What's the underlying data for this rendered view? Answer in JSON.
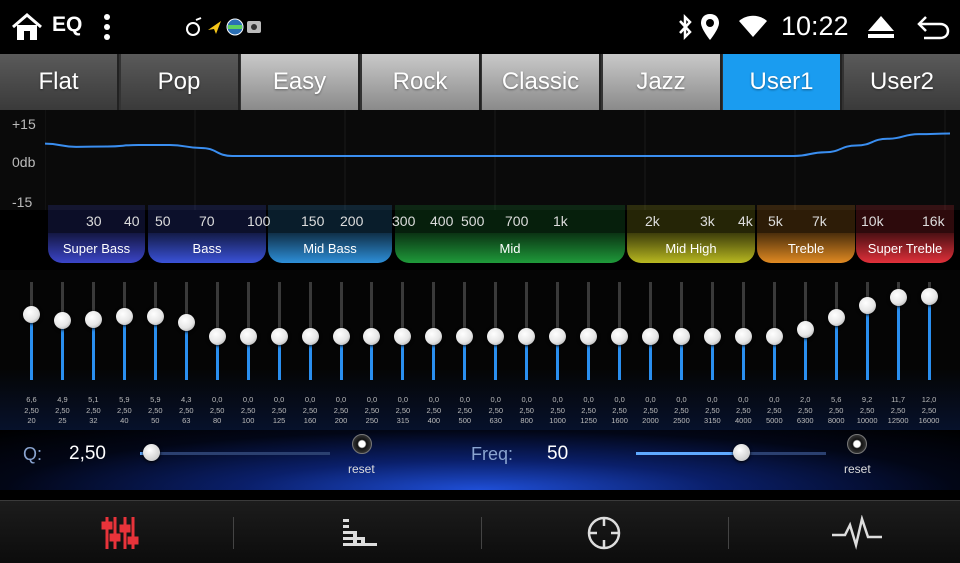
{
  "statusbar": {
    "title": "EQ",
    "time": "10:22",
    "icons": [
      "home-icon",
      "menu-dots-icon",
      "music-notif-icon",
      "nav-notif-icon",
      "globe-notif-icon",
      "camera-notif-icon",
      "bluetooth-icon",
      "location-icon",
      "wifi-icon",
      "eject-icon",
      "back-icon"
    ]
  },
  "presets": [
    {
      "label": "Flat"
    },
    {
      "label": "Pop"
    },
    {
      "label": "Easy"
    },
    {
      "label": "Rock"
    },
    {
      "label": "Classic"
    },
    {
      "label": "Jazz"
    },
    {
      "label": "User1",
      "active": true
    },
    {
      "label": "User2"
    }
  ],
  "graph": {
    "ymax": "+15",
    "ymid": "0db",
    "ymin": "-15"
  },
  "freq_labels": [
    "30",
    "40",
    "50",
    "70",
    "100",
    "150",
    "200",
    "300",
    "400",
    "500",
    "700",
    "1k",
    "2k",
    "3k",
    "4k",
    "5k",
    "7k",
    "10k",
    "16k"
  ],
  "bands": [
    {
      "label": "Super Bass",
      "color": "#3b45c8"
    },
    {
      "label": "Bass",
      "color": "#3a52d8"
    },
    {
      "label": "Mid Bass",
      "color": "#2d8fd8"
    },
    {
      "label": "Mid",
      "color": "#1f9a3a"
    },
    {
      "label": "Mid High",
      "color": "#b8b820"
    },
    {
      "label": "Treble",
      "color": "#e08a22"
    },
    {
      "label": "Super Treble",
      "color": "#e0303a"
    }
  ],
  "eq_bands": [
    {
      "gain": "6,6",
      "q": "2,50",
      "freq": "20",
      "level": 6.6
    },
    {
      "gain": "4,9",
      "q": "2,50",
      "freq": "25",
      "level": 4.9
    },
    {
      "gain": "5,1",
      "q": "2,50",
      "freq": "32",
      "level": 5.1
    },
    {
      "gain": "5,9",
      "q": "2,50",
      "freq": "40",
      "level": 5.9
    },
    {
      "gain": "5,9",
      "q": "2,50",
      "freq": "50",
      "level": 5.9
    },
    {
      "gain": "4,3",
      "q": "2,50",
      "freq": "63",
      "level": 4.3
    },
    {
      "gain": "0,0",
      "q": "2,50",
      "freq": "80",
      "level": 0
    },
    {
      "gain": "0,0",
      "q": "2,50",
      "freq": "100",
      "level": 0
    },
    {
      "gain": "0,0",
      "q": "2,50",
      "freq": "125",
      "level": 0
    },
    {
      "gain": "0,0",
      "q": "2,50",
      "freq": "160",
      "level": 0
    },
    {
      "gain": "0,0",
      "q": "2,50",
      "freq": "200",
      "level": 0
    },
    {
      "gain": "0,0",
      "q": "2,50",
      "freq": "250",
      "level": 0
    },
    {
      "gain": "0,0",
      "q": "2,50",
      "freq": "315",
      "level": 0
    },
    {
      "gain": "0,0",
      "q": "2,50",
      "freq": "400",
      "level": 0
    },
    {
      "gain": "0,0",
      "q": "2,50",
      "freq": "500",
      "level": 0
    },
    {
      "gain": "0,0",
      "q": "2,50",
      "freq": "630",
      "level": 0
    },
    {
      "gain": "0,0",
      "q": "2,50",
      "freq": "800",
      "level": 0
    },
    {
      "gain": "0,0",
      "q": "2,50",
      "freq": "1000",
      "level": 0
    },
    {
      "gain": "0,0",
      "q": "2,50",
      "freq": "1250",
      "level": 0
    },
    {
      "gain": "0,0",
      "q": "2,50",
      "freq": "1600",
      "level": 0
    },
    {
      "gain": "0,0",
      "q": "2,50",
      "freq": "2000",
      "level": 0
    },
    {
      "gain": "0,0",
      "q": "2,50",
      "freq": "2500",
      "level": 0
    },
    {
      "gain": "0,0",
      "q": "2,50",
      "freq": "3150",
      "level": 0
    },
    {
      "gain": "0,0",
      "q": "2,50",
      "freq": "4000",
      "level": 0
    },
    {
      "gain": "0,0",
      "q": "2,50",
      "freq": "5000",
      "level": 0
    },
    {
      "gain": "2,0",
      "q": "2,50",
      "freq": "6300",
      "level": 2.0
    },
    {
      "gain": "5,6",
      "q": "2,50",
      "freq": "8000",
      "level": 5.6
    },
    {
      "gain": "9,2",
      "q": "2,50",
      "freq": "10000",
      "level": 9.2
    },
    {
      "gain": "11,7",
      "q": "2,50",
      "freq": "12500",
      "level": 11.7
    },
    {
      "gain": "12,0",
      "q": "2,50",
      "freq": "16000",
      "level": 12.0
    }
  ],
  "q_control": {
    "label": "Q:",
    "value": "2,50",
    "reset_label": "reset",
    "position": 0.06
  },
  "freq_control": {
    "label": "Freq:",
    "value": "50",
    "reset_label": "reset",
    "position": 0.55
  },
  "bottom_nav": [
    {
      "icon": "equalizer-sliders-icon",
      "active": true
    },
    {
      "icon": "level-bars-icon"
    },
    {
      "icon": "crosshair-balance-icon"
    },
    {
      "icon": "pulse-wave-icon"
    }
  ]
}
